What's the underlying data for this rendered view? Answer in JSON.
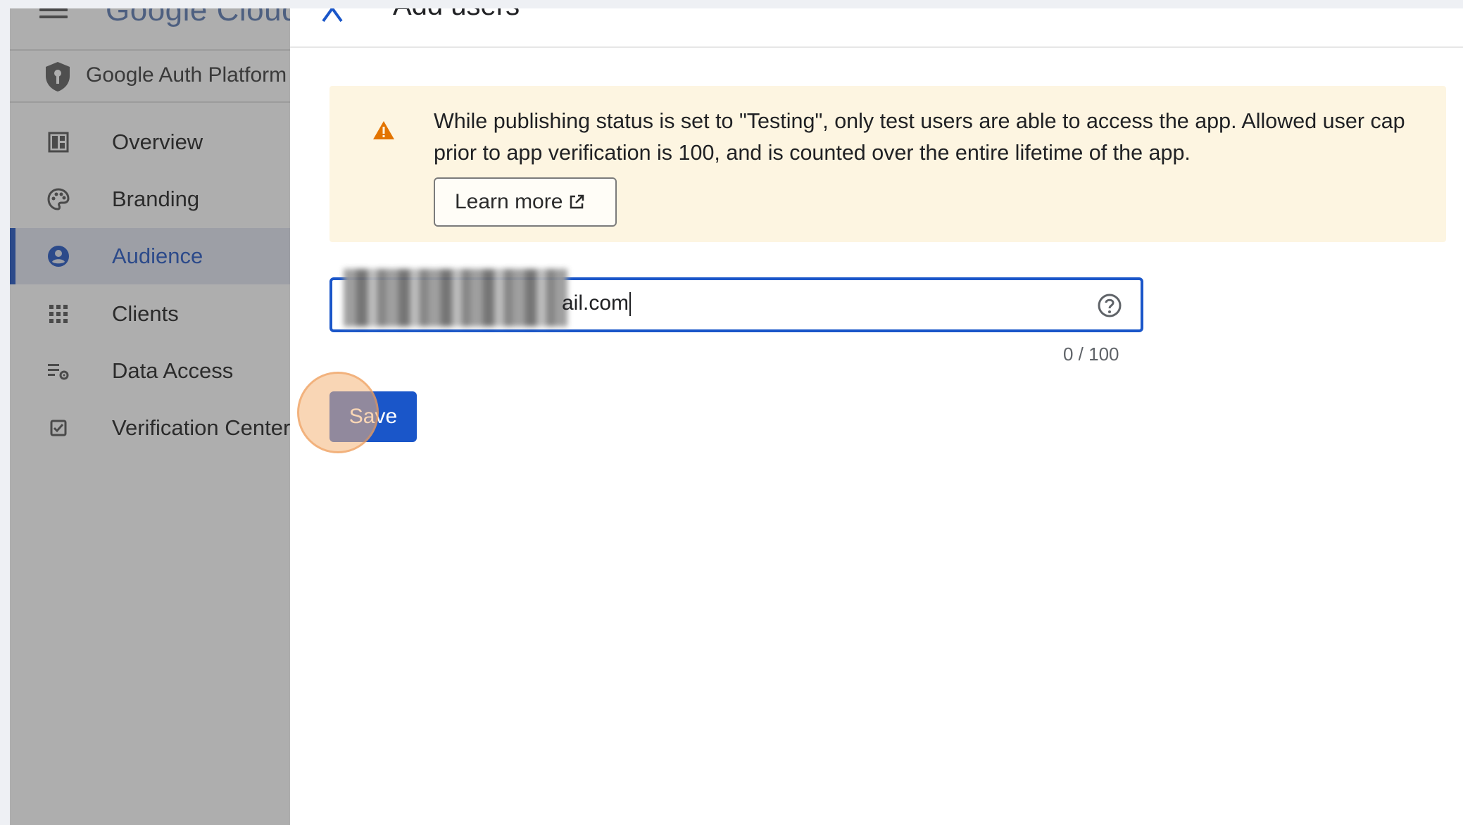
{
  "app": {
    "logo_text": "Google Cloud",
    "product_name": "Google Auth Platform"
  },
  "sidebar": {
    "items": [
      {
        "label": "Overview",
        "icon": "dashboard-icon",
        "active": false
      },
      {
        "label": "Branding",
        "icon": "palette-icon",
        "active": false
      },
      {
        "label": "Audience",
        "icon": "account-circle-icon",
        "active": true
      },
      {
        "label": "Clients",
        "icon": "apps-grid-icon",
        "active": false
      },
      {
        "label": "Data Access",
        "icon": "list-settings-icon",
        "active": false
      },
      {
        "label": "Verification Center",
        "icon": "checkbox-icon",
        "active": false
      }
    ]
  },
  "panel": {
    "title": "Add users",
    "warning": {
      "text": "While publishing status is set to \"Testing\", only test users are able to access the app. Allowed user cap prior to app verification is 100, and is counted over the entire lifetime of the app.",
      "learn_more_label": "Learn more"
    },
    "email_input": {
      "visible_value": "ail.com",
      "counter": "0 / 100"
    },
    "save_label": "Save"
  },
  "colors": {
    "primary": "#1a56c9",
    "warning_bg": "#fdf5e1",
    "warning_icon": "#e37400",
    "sidebar_dim": "#aeaeae"
  }
}
